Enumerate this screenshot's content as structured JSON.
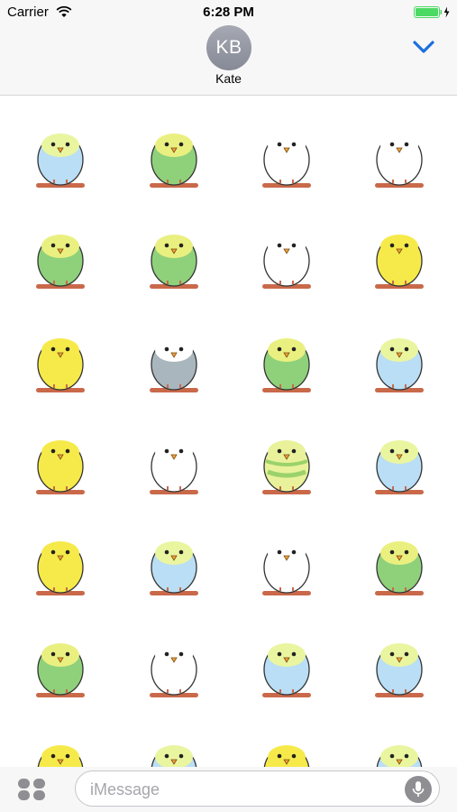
{
  "status_bar": {
    "carrier": "Carrier",
    "time": "6:28 PM",
    "battery_color": "#4cd964"
  },
  "header": {
    "avatar_initials": "KB",
    "contact_name": "Kate",
    "accent_color": "#1c6fe0"
  },
  "composer": {
    "placeholder": "iMessage"
  },
  "stickers": [
    "budgie-pair-singing",
    "budgie-green-flying",
    "budgie-peeking-door",
    "budgie-white-celebrating",
    "budgie-green-pair-hopping",
    "budgie-green-hugging-notes",
    "budgie-white-blue-sitting",
    "budgie-yellow-spreading-wings",
    "budgie-yellow-round",
    "budgie-white-grey-tilted",
    "budgie-green-idea",
    "budgie-blue-rose",
    "budgie-yellow-diving",
    "budgie-white-blue-standing",
    "budgie-striped-round",
    "budgie-blue-sparkle",
    "budgie-yellow-green-surprised",
    "budgie-blue-question",
    "budgie-white-standing",
    "budgie-green-peanut",
    "budgie-green-leaf",
    "budgie-white-fluffed",
    "budgie-blue-droplet",
    "budgie-blue-flying",
    "budgie-partial-1",
    "budgie-partial-2",
    "budgie-partial-3",
    "budgie-partial-4"
  ]
}
